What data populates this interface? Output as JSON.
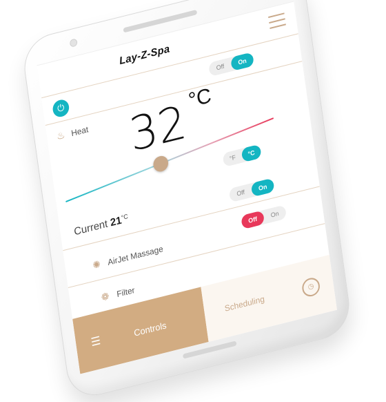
{
  "app": {
    "brand": "Lay-Z-Spa"
  },
  "heat": {
    "label": "Heat",
    "toggle": {
      "off": "Off",
      "on": "On",
      "state": "on"
    },
    "set_temp": "32",
    "set_unit": "°C",
    "slider_level": 0.45,
    "units_toggle": {
      "f": "°F",
      "c": "°C",
      "state": "c"
    },
    "current_label": "Current",
    "current_value": "21",
    "current_unit": "°C"
  },
  "airjet": {
    "label": "AirJet Massage",
    "toggle": {
      "off": "Off",
      "on": "On",
      "state": "on"
    }
  },
  "filter": {
    "label": "Filter",
    "toggle": {
      "off": "Off",
      "on": "On",
      "state": "off"
    }
  },
  "tabs": {
    "controls": "Controls",
    "scheduling": "Scheduling"
  },
  "colors": {
    "accent_teal": "#14b5c2",
    "accent_tan": "#d2ac82",
    "accent_red": "#e8385a"
  },
  "icons": {
    "power": "power-icon",
    "menu": "menu-icon",
    "heat": "heat-icon",
    "airjet": "airjet-icon",
    "filter": "filter-icon",
    "controls": "sliders-icon",
    "scheduling": "stopwatch-icon"
  }
}
